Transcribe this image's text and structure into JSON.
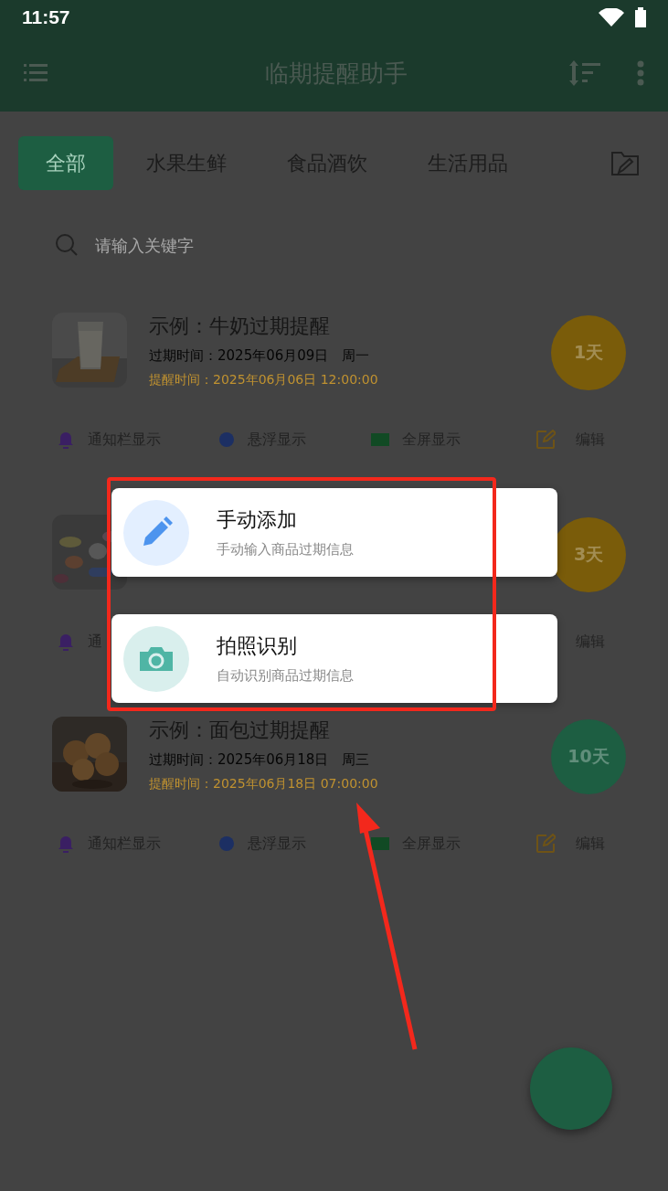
{
  "status_bar": {
    "time": "11:57"
  },
  "header": {
    "title": "临期提醒助手"
  },
  "tabs": [
    {
      "label": "全部",
      "selected": true
    },
    {
      "label": "水果生鲜",
      "selected": false
    },
    {
      "label": "食品酒饮",
      "selected": false
    },
    {
      "label": "生活用品",
      "selected": false
    }
  ],
  "search": {
    "placeholder": "请输入关键字"
  },
  "items": [
    {
      "title": "示例：牛奶过期提醒",
      "expiry": "过期时间：2025年06月09日   周一",
      "reminder": "提醒时间：2025年06月06日 12:00:00",
      "days": "1天",
      "color": "#7a5c0a",
      "actions": [
        {
          "kind": "notify",
          "label": "通知栏显示"
        },
        {
          "kind": "float",
          "label": "悬浮显示"
        },
        {
          "kind": "fullscreen",
          "label": "全屏显示"
        },
        {
          "kind": "edit",
          "label": "编辑"
        }
      ]
    },
    {
      "days": "3天",
      "color": "#7a5c0a",
      "actions": [
        {
          "kind": "notify",
          "label": "通"
        },
        {
          "kind": "label",
          "label": "编辑"
        }
      ]
    },
    {
      "title": "示例：面包过期提醒",
      "expiry": "过期时间：2025年06月18日   周三",
      "reminder": "提醒时间：2025年06月18日 07:00:00",
      "days": "10天",
      "color": "#1d5e42",
      "actions": [
        {
          "kind": "notify",
          "label": "通知栏显示"
        },
        {
          "kind": "float",
          "label": "悬浮显示"
        },
        {
          "kind": "fullscreen",
          "label": "全屏显示"
        },
        {
          "kind": "edit",
          "label": "编辑"
        }
      ]
    }
  ],
  "add_menu": [
    {
      "kind": "manual",
      "title": "手动添加",
      "subtitle": "手动输入商品过期信息"
    },
    {
      "kind": "camera",
      "title": "拍照识别",
      "subtitle": "自动识别商品过期信息"
    }
  ]
}
